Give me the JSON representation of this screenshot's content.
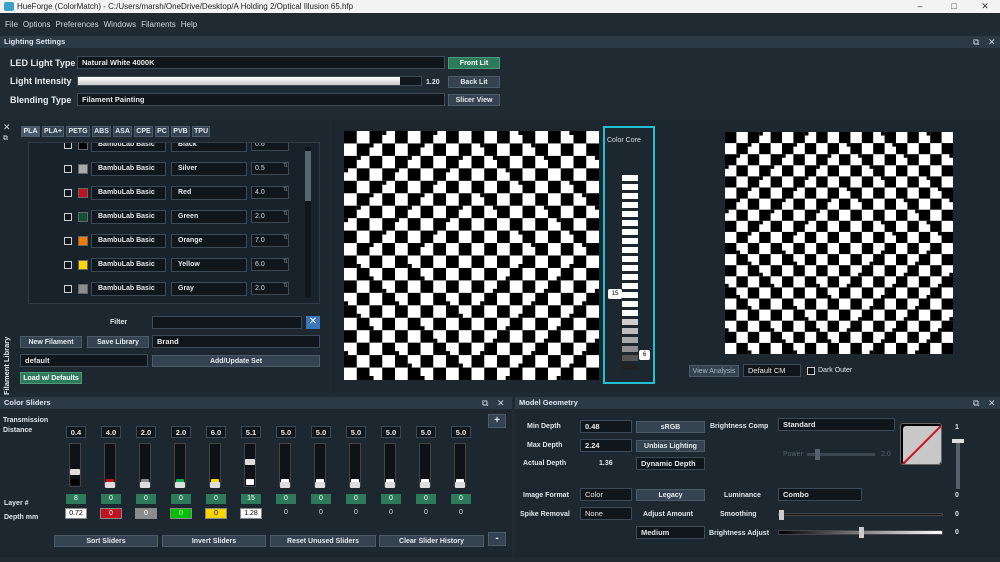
{
  "window": {
    "title": "HueForge (ColorMatch) - C:/Users/marsh/OneDrive/Desktop/A Holding 2/Optical Illusion 65.hfp"
  },
  "menu": [
    "File",
    "Options",
    "Preferences",
    "Windows",
    "Filaments",
    "Help"
  ],
  "lighting": {
    "header": "Lighting Settings",
    "led_label": "LED Light Type",
    "led_value": "Natural White 4000K",
    "intensity_label": "Light Intensity",
    "intensity_value": "1.20",
    "intensity_fraction": 0.94,
    "blending_label": "Blending Type",
    "blending_value": "Filament Painting",
    "front_lit": "Front Lit",
    "back_lit": "Back Lit",
    "slicer_view": "Slicer View"
  },
  "library": {
    "tabs": [
      "PLA",
      "PLA+",
      "PETG",
      "ABS",
      "ASA",
      "CPE",
      "PC",
      "PVB",
      "TPU"
    ],
    "rows": [
      {
        "brand": "BambuLab Basic",
        "name": "Black",
        "td": "0.6",
        "color": "#000000"
      },
      {
        "brand": "BambuLab Basic",
        "name": "Silver",
        "td": "0.5",
        "color": "#a7a9ac"
      },
      {
        "brand": "BambuLab Basic",
        "name": "Red",
        "td": "4.0",
        "color": "#c1121f"
      },
      {
        "brand": "BambuLab Basic",
        "name": "Green",
        "td": "2.0",
        "color": "#0f5132"
      },
      {
        "brand": "BambuLab Basic",
        "name": "Orange",
        "td": "7.0",
        "color": "#f57c00"
      },
      {
        "brand": "BambuLab Basic",
        "name": "Yellow",
        "td": "6.0",
        "color": "#ffd600"
      },
      {
        "brand": "BambuLab Basic",
        "name": "Gray",
        "td": "2.0",
        "color": "#8a8d8f"
      }
    ],
    "filter_label": "Filter",
    "new_filament": "New Filament",
    "save_library": "Save Library",
    "brand_select": "Brand",
    "set_select": "default",
    "add_update": "Add/Update Set",
    "load_defaults": "Load w/ Defaults",
    "side_label": "Filament Library"
  },
  "colorcore": {
    "label": "Color Core",
    "marker_15": "15",
    "marker_6": "6"
  },
  "analysis": {
    "view_analysis": "View Analysis",
    "cm_select": "Default CM",
    "dark_outer": "Dark Outer"
  },
  "sliders": {
    "header": "Color Sliders",
    "transmission_label": "Transmission Distance",
    "layer_label": "Layer #",
    "depth_label": "Depth mm",
    "items": [
      {
        "td": "0.4",
        "layer": "8",
        "depth": "0.72",
        "color": "#000000",
        "level": 0.35,
        "swatch": "#ffffff",
        "textcolor": "#000"
      },
      {
        "td": "4.0",
        "layer": "0",
        "depth": "0",
        "color": "#c1121f",
        "level": 0.0,
        "swatch": "#c1121f",
        "textcolor": "#fff"
      },
      {
        "td": "2.0",
        "layer": "0",
        "depth": "0",
        "color": "#8a8d8f",
        "level": 0.0,
        "swatch": "#8a8d8f",
        "textcolor": "#fff"
      },
      {
        "td": "2.0",
        "layer": "0",
        "depth": "0",
        "color": "#00b050",
        "level": 0.0,
        "swatch": "#00c000",
        "textcolor": "#fff"
      },
      {
        "td": "6.0",
        "layer": "0",
        "depth": "0",
        "color": "#ffd600",
        "level": 0.0,
        "swatch": "#ffd600",
        "textcolor": "#000"
      },
      {
        "td": "5.1",
        "layer": "15",
        "depth": "1.28",
        "color": "#ffffff",
        "level": 0.65,
        "swatch": "#ffffff",
        "textcolor": "#000"
      },
      {
        "td": "5.0",
        "layer": "0",
        "depth": "0",
        "color": "#ffffff",
        "level": 0.0,
        "swatch": "",
        "textcolor": "#ddd"
      },
      {
        "td": "5.0",
        "layer": "0",
        "depth": "0",
        "color": "#ffffff",
        "level": 0.0,
        "swatch": "",
        "textcolor": "#ddd"
      },
      {
        "td": "5.0",
        "layer": "0",
        "depth": "0",
        "color": "#ffffff",
        "level": 0.0,
        "swatch": "",
        "textcolor": "#ddd"
      },
      {
        "td": "5.0",
        "layer": "0",
        "depth": "0",
        "color": "#ffffff",
        "level": 0.0,
        "swatch": "",
        "textcolor": "#ddd"
      },
      {
        "td": "5.0",
        "layer": "0",
        "depth": "0",
        "color": "#ffffff",
        "level": 0.0,
        "swatch": "",
        "textcolor": "#ddd"
      },
      {
        "td": "5.0",
        "layer": "0",
        "depth": "0",
        "color": "#ffffff",
        "level": 0.0,
        "swatch": "",
        "textcolor": "#ddd"
      }
    ],
    "sort": "Sort Sliders",
    "invert": "Invert Sliders",
    "reset": "Reset Unused Sliders",
    "clear": "Clear Slider History",
    "plus": "+",
    "minus": "-"
  },
  "geometry": {
    "header": "Model Geometry",
    "min_depth_label": "Min Depth",
    "min_depth": "0.48",
    "max_depth_label": "Max Depth",
    "max_depth": "2.24",
    "actual_depth_label": "Actual Depth",
    "actual_depth": "1.36",
    "srgb": "sRGB",
    "unbias": "Unbias Lighting",
    "dynamic": "Dynamic Depth",
    "brightness_comp_label": "Brightness Comp",
    "brightness_comp": "Standard",
    "power_label": "Power",
    "power_value": "2.0",
    "image_format_label": "Image Format",
    "image_format": "Color",
    "legacy": "Legacy",
    "luminance_label": "Luminance",
    "luminance": "Combo",
    "spike_label": "Spike Removal",
    "spike": "None",
    "adjust_amount_label": "Adjust Amount",
    "smoothing_label": "Smoothing",
    "medium": "Medium",
    "brightness_adjust_label": "Brightness Adjust",
    "val_1": "1",
    "val_0a": "0",
    "val_0b": "0",
    "val_0c": "0"
  }
}
